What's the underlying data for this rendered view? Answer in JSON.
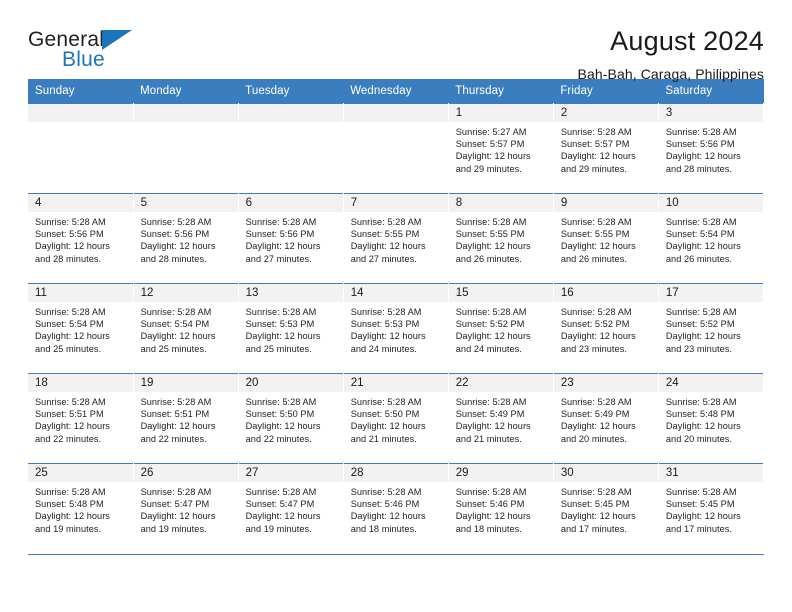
{
  "brand": {
    "name_part1": "General",
    "name_part2": "Blue",
    "logo_icon": "blue-triangle-flag"
  },
  "header": {
    "title": "August 2024",
    "subtitle": "Bah-Bah, Caraga, Philippines"
  },
  "calendar": {
    "weekday_headers": [
      "Sunday",
      "Monday",
      "Tuesday",
      "Wednesday",
      "Thursday",
      "Friday",
      "Saturday"
    ],
    "accent_color": "#3b7ebf",
    "daynum_band_color": "#f2f2f2",
    "weeks": [
      [
        {
          "day": "",
          "blank": true
        },
        {
          "day": "",
          "blank": true
        },
        {
          "day": "",
          "blank": true
        },
        {
          "day": "",
          "blank": true
        },
        {
          "day": "1",
          "sunrise": "Sunrise: 5:27 AM",
          "sunset": "Sunset: 5:57 PM",
          "daylight1": "Daylight: 12 hours",
          "daylight2": "and 29 minutes."
        },
        {
          "day": "2",
          "sunrise": "Sunrise: 5:28 AM",
          "sunset": "Sunset: 5:57 PM",
          "daylight1": "Daylight: 12 hours",
          "daylight2": "and 29 minutes."
        },
        {
          "day": "3",
          "sunrise": "Sunrise: 5:28 AM",
          "sunset": "Sunset: 5:56 PM",
          "daylight1": "Daylight: 12 hours",
          "daylight2": "and 28 minutes."
        }
      ],
      [
        {
          "day": "4",
          "sunrise": "Sunrise: 5:28 AM",
          "sunset": "Sunset: 5:56 PM",
          "daylight1": "Daylight: 12 hours",
          "daylight2": "and 28 minutes."
        },
        {
          "day": "5",
          "sunrise": "Sunrise: 5:28 AM",
          "sunset": "Sunset: 5:56 PM",
          "daylight1": "Daylight: 12 hours",
          "daylight2": "and 28 minutes."
        },
        {
          "day": "6",
          "sunrise": "Sunrise: 5:28 AM",
          "sunset": "Sunset: 5:56 PM",
          "daylight1": "Daylight: 12 hours",
          "daylight2": "and 27 minutes."
        },
        {
          "day": "7",
          "sunrise": "Sunrise: 5:28 AM",
          "sunset": "Sunset: 5:55 PM",
          "daylight1": "Daylight: 12 hours",
          "daylight2": "and 27 minutes."
        },
        {
          "day": "8",
          "sunrise": "Sunrise: 5:28 AM",
          "sunset": "Sunset: 5:55 PM",
          "daylight1": "Daylight: 12 hours",
          "daylight2": "and 26 minutes."
        },
        {
          "day": "9",
          "sunrise": "Sunrise: 5:28 AM",
          "sunset": "Sunset: 5:55 PM",
          "daylight1": "Daylight: 12 hours",
          "daylight2": "and 26 minutes."
        },
        {
          "day": "10",
          "sunrise": "Sunrise: 5:28 AM",
          "sunset": "Sunset: 5:54 PM",
          "daylight1": "Daylight: 12 hours",
          "daylight2": "and 26 minutes."
        }
      ],
      [
        {
          "day": "11",
          "sunrise": "Sunrise: 5:28 AM",
          "sunset": "Sunset: 5:54 PM",
          "daylight1": "Daylight: 12 hours",
          "daylight2": "and 25 minutes."
        },
        {
          "day": "12",
          "sunrise": "Sunrise: 5:28 AM",
          "sunset": "Sunset: 5:54 PM",
          "daylight1": "Daylight: 12 hours",
          "daylight2": "and 25 minutes."
        },
        {
          "day": "13",
          "sunrise": "Sunrise: 5:28 AM",
          "sunset": "Sunset: 5:53 PM",
          "daylight1": "Daylight: 12 hours",
          "daylight2": "and 25 minutes."
        },
        {
          "day": "14",
          "sunrise": "Sunrise: 5:28 AM",
          "sunset": "Sunset: 5:53 PM",
          "daylight1": "Daylight: 12 hours",
          "daylight2": "and 24 minutes."
        },
        {
          "day": "15",
          "sunrise": "Sunrise: 5:28 AM",
          "sunset": "Sunset: 5:52 PM",
          "daylight1": "Daylight: 12 hours",
          "daylight2": "and 24 minutes."
        },
        {
          "day": "16",
          "sunrise": "Sunrise: 5:28 AM",
          "sunset": "Sunset: 5:52 PM",
          "daylight1": "Daylight: 12 hours",
          "daylight2": "and 23 minutes."
        },
        {
          "day": "17",
          "sunrise": "Sunrise: 5:28 AM",
          "sunset": "Sunset: 5:52 PM",
          "daylight1": "Daylight: 12 hours",
          "daylight2": "and 23 minutes."
        }
      ],
      [
        {
          "day": "18",
          "sunrise": "Sunrise: 5:28 AM",
          "sunset": "Sunset: 5:51 PM",
          "daylight1": "Daylight: 12 hours",
          "daylight2": "and 22 minutes."
        },
        {
          "day": "19",
          "sunrise": "Sunrise: 5:28 AM",
          "sunset": "Sunset: 5:51 PM",
          "daylight1": "Daylight: 12 hours",
          "daylight2": "and 22 minutes."
        },
        {
          "day": "20",
          "sunrise": "Sunrise: 5:28 AM",
          "sunset": "Sunset: 5:50 PM",
          "daylight1": "Daylight: 12 hours",
          "daylight2": "and 22 minutes."
        },
        {
          "day": "21",
          "sunrise": "Sunrise: 5:28 AM",
          "sunset": "Sunset: 5:50 PM",
          "daylight1": "Daylight: 12 hours",
          "daylight2": "and 21 minutes."
        },
        {
          "day": "22",
          "sunrise": "Sunrise: 5:28 AM",
          "sunset": "Sunset: 5:49 PM",
          "daylight1": "Daylight: 12 hours",
          "daylight2": "and 21 minutes."
        },
        {
          "day": "23",
          "sunrise": "Sunrise: 5:28 AM",
          "sunset": "Sunset: 5:49 PM",
          "daylight1": "Daylight: 12 hours",
          "daylight2": "and 20 minutes."
        },
        {
          "day": "24",
          "sunrise": "Sunrise: 5:28 AM",
          "sunset": "Sunset: 5:48 PM",
          "daylight1": "Daylight: 12 hours",
          "daylight2": "and 20 minutes."
        }
      ],
      [
        {
          "day": "25",
          "sunrise": "Sunrise: 5:28 AM",
          "sunset": "Sunset: 5:48 PM",
          "daylight1": "Daylight: 12 hours",
          "daylight2": "and 19 minutes."
        },
        {
          "day": "26",
          "sunrise": "Sunrise: 5:28 AM",
          "sunset": "Sunset: 5:47 PM",
          "daylight1": "Daylight: 12 hours",
          "daylight2": "and 19 minutes."
        },
        {
          "day": "27",
          "sunrise": "Sunrise: 5:28 AM",
          "sunset": "Sunset: 5:47 PM",
          "daylight1": "Daylight: 12 hours",
          "daylight2": "and 19 minutes."
        },
        {
          "day": "28",
          "sunrise": "Sunrise: 5:28 AM",
          "sunset": "Sunset: 5:46 PM",
          "daylight1": "Daylight: 12 hours",
          "daylight2": "and 18 minutes."
        },
        {
          "day": "29",
          "sunrise": "Sunrise: 5:28 AM",
          "sunset": "Sunset: 5:46 PM",
          "daylight1": "Daylight: 12 hours",
          "daylight2": "and 18 minutes."
        },
        {
          "day": "30",
          "sunrise": "Sunrise: 5:28 AM",
          "sunset": "Sunset: 5:45 PM",
          "daylight1": "Daylight: 12 hours",
          "daylight2": "and 17 minutes."
        },
        {
          "day": "31",
          "sunrise": "Sunrise: 5:28 AM",
          "sunset": "Sunset: 5:45 PM",
          "daylight1": "Daylight: 12 hours",
          "daylight2": "and 17 minutes."
        }
      ]
    ]
  }
}
